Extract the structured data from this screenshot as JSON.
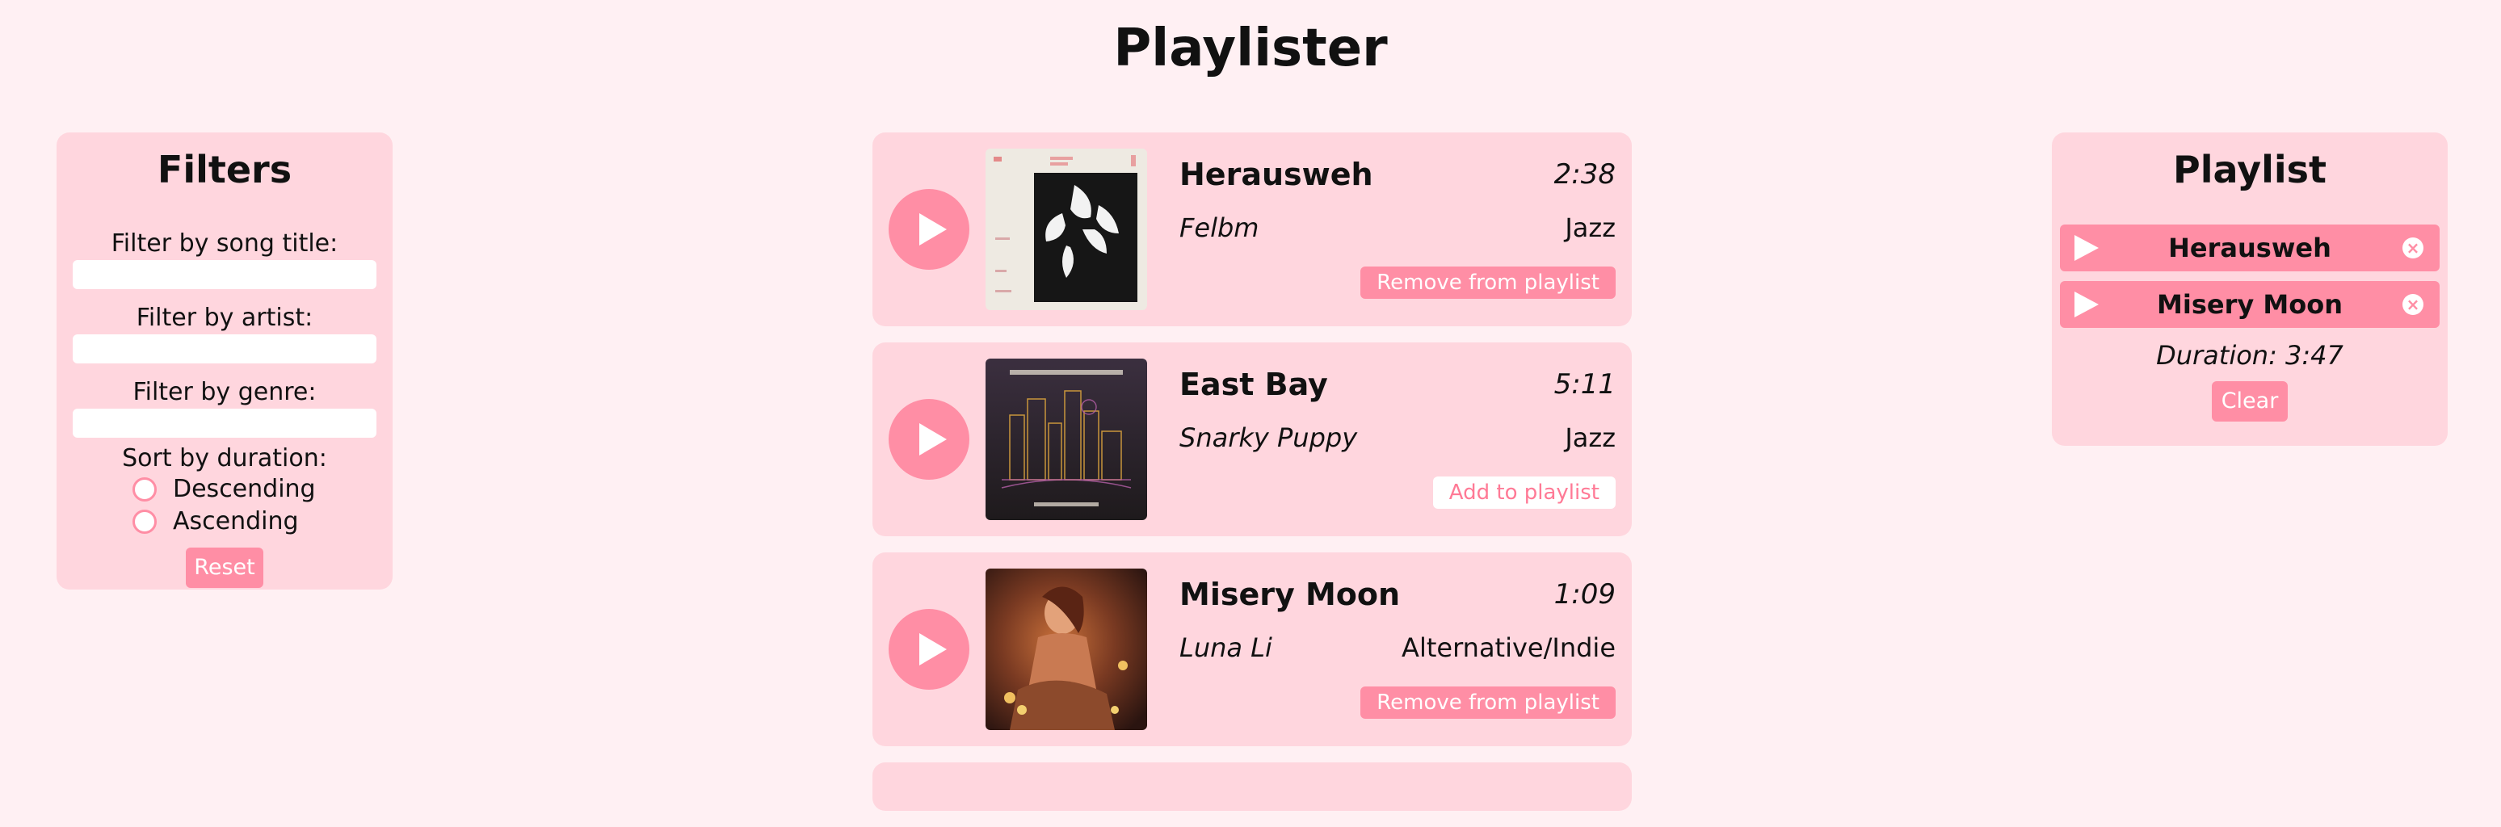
{
  "app": {
    "title": "Playlister"
  },
  "filters": {
    "heading": "Filters",
    "title_label": "Filter by song title:",
    "artist_label": "Filter by artist:",
    "genre_label": "Filter by genre:",
    "sort_label": "Sort by duration:",
    "sort_options": [
      "Descending",
      "Ascending"
    ],
    "reset_label": "Reset"
  },
  "songs": [
    {
      "title": "Herausweh",
      "duration": "2:38",
      "artist": "Felbm",
      "genre": "Jazz",
      "action": "Remove from playlist",
      "in_playlist": true
    },
    {
      "title": "East Bay",
      "duration": "5:11",
      "artist": "Snarky Puppy",
      "genre": "Jazz",
      "action": "Add to playlist",
      "in_playlist": false
    },
    {
      "title": "Misery Moon",
      "duration": "1:09",
      "artist": "Luna Li",
      "genre": "Alternative/Indie",
      "action": "Remove from playlist",
      "in_playlist": true
    }
  ],
  "playlist": {
    "heading": "Playlist",
    "items": [
      "Herausweh",
      "Misery Moon"
    ],
    "duration": "Duration: 3:47",
    "clear_label": "Clear"
  },
  "colors": {
    "accent": "#ff8ea5",
    "panel": "#ffd6de",
    "background": "#fff0f3"
  }
}
